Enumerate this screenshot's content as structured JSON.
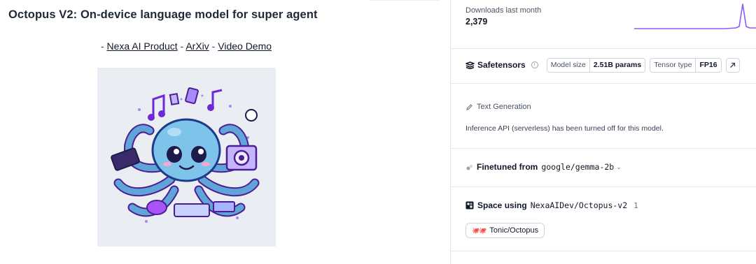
{
  "model_card": {
    "title": "Octopus V2: On-device language model for super agent",
    "links_prefix": "- ",
    "links": [
      {
        "label": "Nexa AI Product"
      },
      {
        "label": "ArXiv"
      },
      {
        "label": "Video Demo"
      }
    ],
    "link_separator": " - ",
    "hero_image_alt": "octopus illustration"
  },
  "downloads": {
    "label": "Downloads last month",
    "count": "2,379",
    "sparkline_color": "#8b5cf6"
  },
  "safetensors": {
    "icon": "safetensors-icon",
    "label": "Safetensors",
    "model_size_key": "Model size",
    "model_size_value": "2.51B params",
    "tensor_type_key": "Tensor type",
    "tensor_type_value": "FP16",
    "external_icon": "arrow-up-right-icon"
  },
  "inference": {
    "tag_icon": "pencil-icon",
    "tag": "Text Generation",
    "message": "Inference API (serverless) has been turned off for this model."
  },
  "finetuned": {
    "icon": "finetune-icon",
    "label": "Finetuned from",
    "model": "google/gemma-2b"
  },
  "spaces": {
    "icon": "spaces-icon",
    "label": "Space using",
    "repo": "NexaAIDev/Octopus-v2",
    "count": "1",
    "items": [
      {
        "label": "Tonic/Octopus",
        "emoji": "🐙🐙"
      }
    ]
  },
  "colors": {
    "accent_purple": "#8b5cf6",
    "border": "#e5e7eb",
    "hero_bg": "#eaeef3"
  }
}
